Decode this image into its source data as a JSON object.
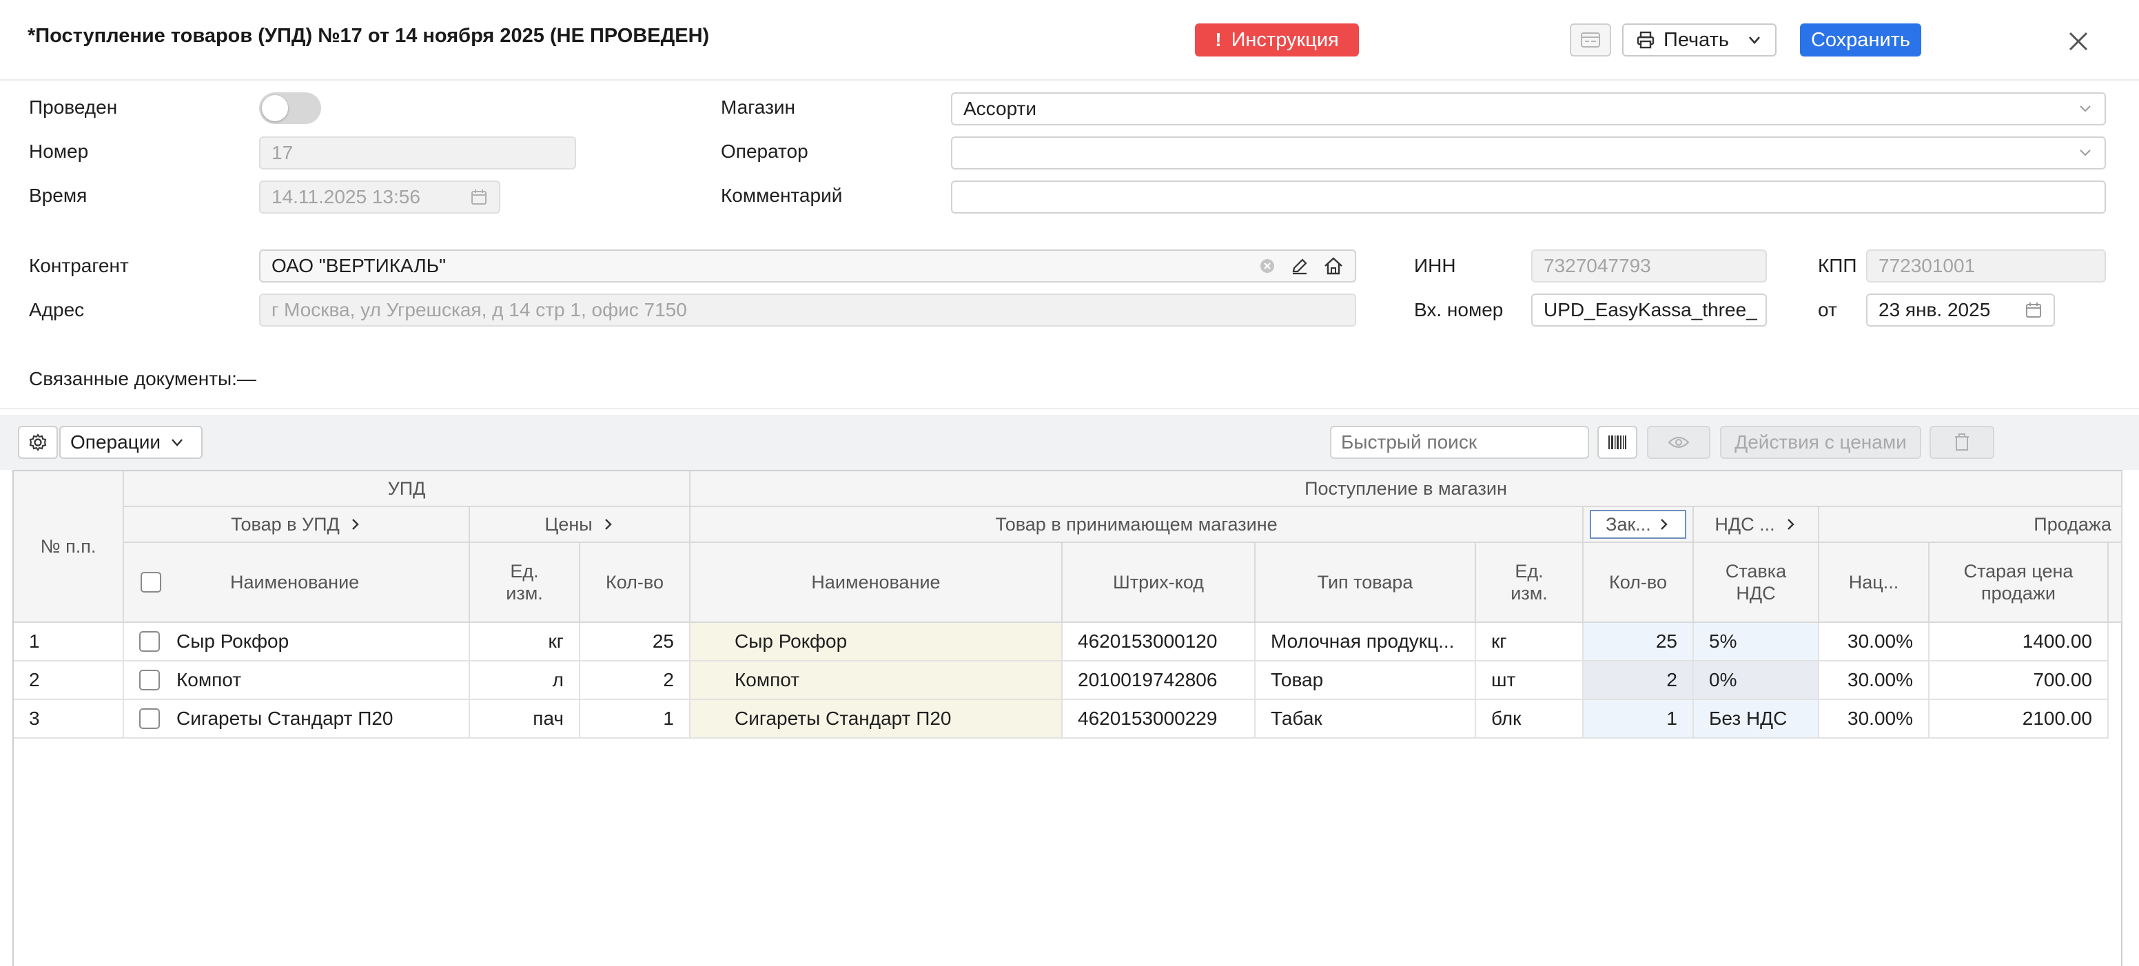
{
  "header": {
    "title": "*Поступление товаров (УПД) №17 от 14 ноября 2025 (НЕ ПРОВЕДЕН)",
    "instruction_label": "Инструкция",
    "instruction_mark": "!",
    "print_label": "Печать",
    "save_label": "Сохранить",
    "accent_color": "#2b73e8",
    "danger_color": "#ee4a4a"
  },
  "form": {
    "posted_label": "Проведен",
    "posted_value": false,
    "number_label": "Номер",
    "number_value": "17",
    "time_label": "Время",
    "time_value": "14.11.2025 13:56",
    "store_label": "Магазин",
    "store_value": "Ассорти",
    "operator_label": "Оператор",
    "operator_value": "",
    "comment_label": "Комментарий",
    "comment_value": "",
    "counterparty_label": "Контрагент",
    "counterparty_value": "ОАО \"ВЕРТИКАЛЬ\"",
    "address_label": "Адрес",
    "address_value": "г Москва, ул Угрешская, д 14 стр 1, офис 7150",
    "inn_label": "ИНН",
    "inn_value": "7327047793",
    "kpp_label": "КПП",
    "kpp_value": "772301001",
    "incoming_number_label": "Вх. номер",
    "incoming_number_value": "UPD_EasyKassa_three_",
    "from_label": "от",
    "from_date_value": "23 янв. 2025",
    "related_docs_label": "Связанные документы:—"
  },
  "toolbar": {
    "operations_label": "Операции",
    "search_placeholder": "Быстрый поиск",
    "price_actions_label": "Действия с ценами"
  },
  "table": {
    "groups": {
      "upd": "УПД",
      "receipt": "Поступление в магазин"
    },
    "subgroups": {
      "upd_item": "Товар в УПД",
      "prices": "Цены",
      "store_item": "Товар в принимающем магазине",
      "order": "Зак...",
      "vat": "НДС ...",
      "sale": "Продажа"
    },
    "columns": {
      "num": "№ п.п.",
      "name": "Наименование",
      "unit": "Ед. изм.",
      "qty": "Кол-во",
      "store_name": "Наименование",
      "barcode": "Штрих-код",
      "type": "Тип товара",
      "store_unit": "Ед. изм.",
      "store_qty": "Кол-во",
      "vat_rate": "Ставка НДС",
      "markup": "Нац...",
      "old_price": "Старая цена продажи"
    },
    "rows": [
      {
        "num": "1",
        "name": "Сыр Рокфор",
        "unit": "кг",
        "qty": "25",
        "store_name": "Сыр Рокфор",
        "barcode": "4620153000120",
        "type": "Молочная продукц...",
        "store_unit": "кг",
        "store_qty": "25",
        "vat": "5%",
        "markup": "30.00%",
        "old_price": "1400.00"
      },
      {
        "num": "2",
        "name": "Компот",
        "unit": "л",
        "qty": "2",
        "store_name": "Компот",
        "barcode": "2010019742806",
        "type": "Товар",
        "store_unit": "шт",
        "store_qty": "2",
        "vat": "0%",
        "markup": "30.00%",
        "old_price": "700.00"
      },
      {
        "num": "3",
        "name": "Сигареты Стандарт П20",
        "unit": "пач",
        "qty": "1",
        "store_name": "Сигареты Стандарт П20",
        "barcode": "4620153000229",
        "type": "Табак",
        "store_unit": "блк",
        "store_qty": "1",
        "vat": "Без НДС",
        "markup": "30.00%",
        "old_price": "2100.00"
      }
    ]
  }
}
